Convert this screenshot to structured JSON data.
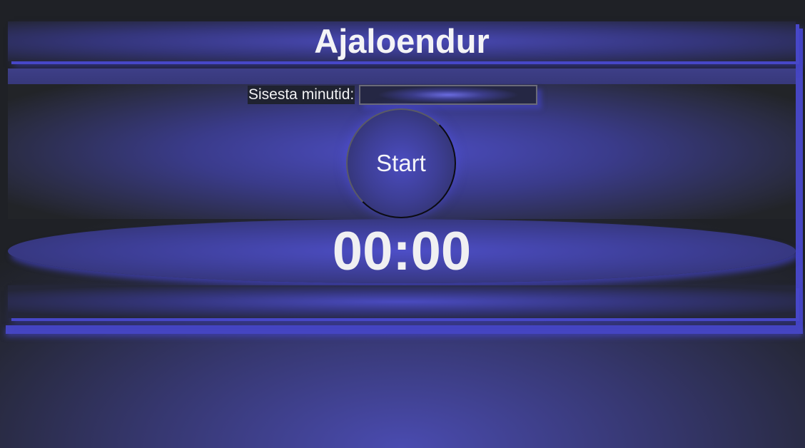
{
  "app": {
    "title": "Ajaloendur"
  },
  "input": {
    "label": "Sisesta minutid:",
    "value": "",
    "placeholder": ""
  },
  "controls": {
    "start_label": "Start"
  },
  "timer": {
    "display": "00:00"
  },
  "colors": {
    "accent": "#4747c8",
    "panel_center": "#4c4dc2",
    "background_dark": "#222428",
    "text": "#f2f2f4"
  }
}
